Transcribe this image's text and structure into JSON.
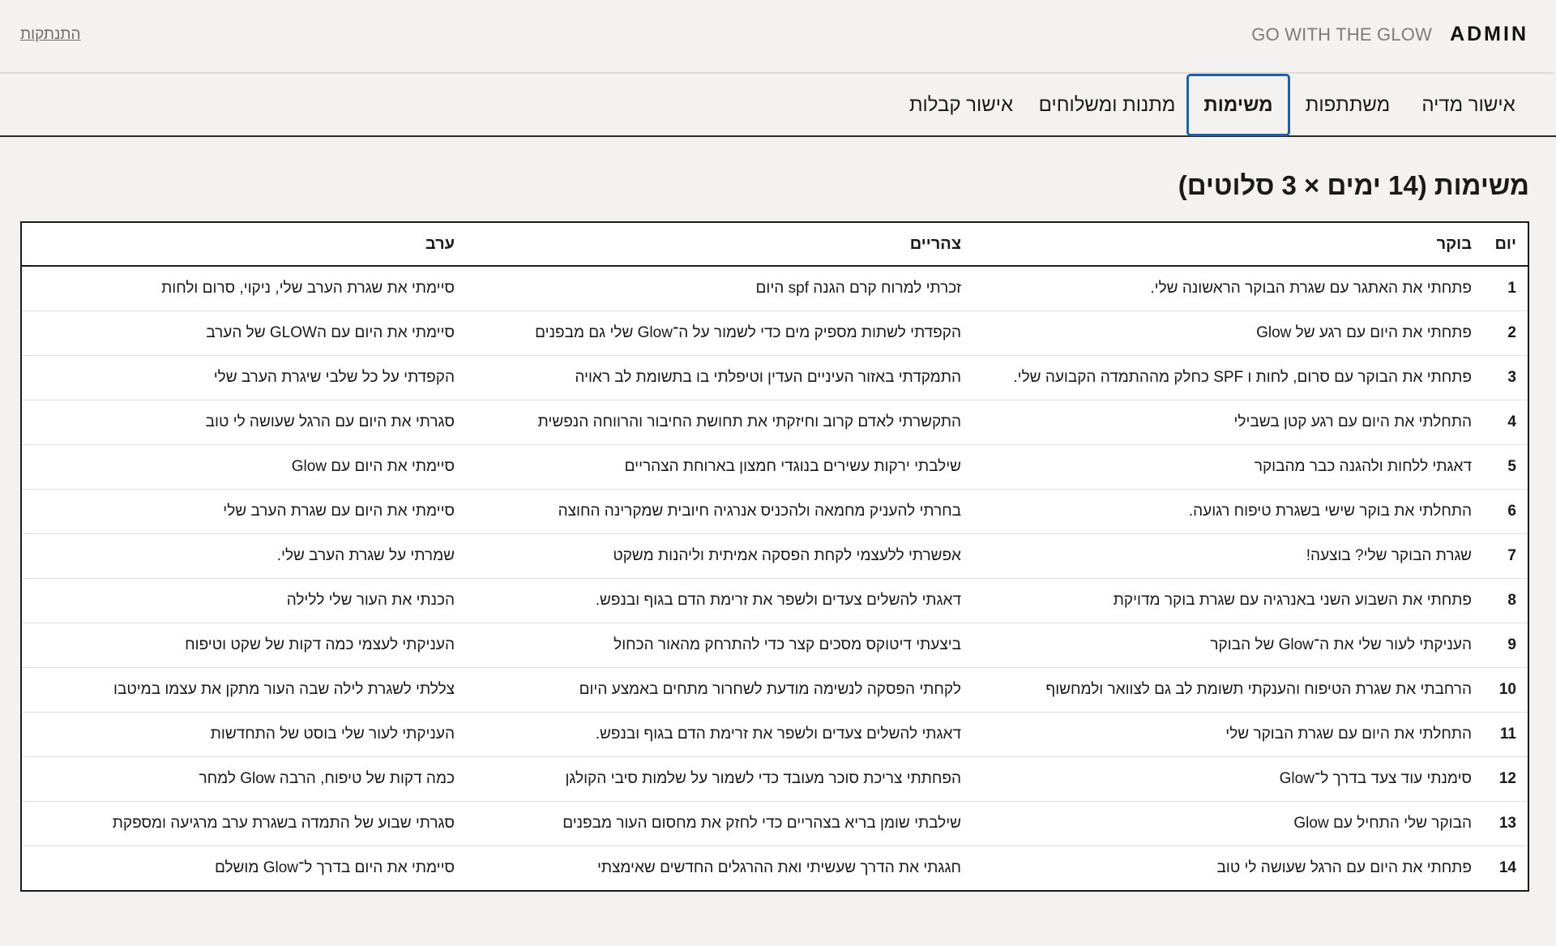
{
  "header": {
    "admin_label": "ADMIN",
    "tagline": "GO WITH THE GLOW",
    "logout_label": "התנתקות"
  },
  "tabs": [
    {
      "label": "אישור מדיה",
      "active": false
    },
    {
      "label": "משתתפות",
      "active": false
    },
    {
      "label": "משימות",
      "active": true
    },
    {
      "label": "מתנות ומשלוחים",
      "active": false
    },
    {
      "label": "אישור קבלות",
      "active": false
    }
  ],
  "page": {
    "title": "משימות (14 ימים × 3 סלוטים)"
  },
  "colors": {
    "background": "#f3f2f0",
    "active_tab_border": "#1f5fa8",
    "table_border": "#1a1a1a"
  },
  "table": {
    "headers": {
      "day": "יום",
      "morning": "בוקר",
      "noon": "צהריים",
      "evening": "ערב"
    },
    "rows": [
      {
        "day": "1",
        "morning": "פתחתי את האתגר עם שגרת הבוקר הראשונה שלי.",
        "noon": "זכרתי למרוח קרם הגנה spf היום",
        "evening": "סיימתי את שגרת הערב שלי, ניקוי, סרום ולחות"
      },
      {
        "day": "2",
        "morning": "פתחתי את היום עם רגע של Glow",
        "noon": "הקפדתי לשתות מספיק מים כדי לשמור על ה־Glow שלי גם מבפנים",
        "evening": "סיימתי את היום עם הGLOW של הערב"
      },
      {
        "day": "3",
        "morning": "פתחתי את הבוקר עם סרום, לחות ו SPF כחלק מההתמדה הקבועה שלי.",
        "noon": "התמקדתי באזור העיניים העדין וטיפלתי בו בתשומת לב ראויה",
        "evening": "הקפדתי על כל שלבי שיגרת הערב שלי"
      },
      {
        "day": "4",
        "morning": "התחלתי את היום עם רגע קטן בשבילי",
        "noon": "התקשרתי לאדם קרוב וחיזקתי את תחושת החיבור והרווחה הנפשית",
        "evening": "סגרתי את היום עם הרגל שעושה לי טוב"
      },
      {
        "day": "5",
        "morning": "דאגתי ללחות ולהגנה כבר מהבוקר",
        "noon": "שילבתי ירקות עשירים בנוגדי חמצון בארוחת הצהריים",
        "evening": "סיימתי את היום עם Glow"
      },
      {
        "day": "6",
        "morning": "התחלתי את בוקר שישי בשגרת טיפוח רגועה.",
        "noon": "בחרתי להעניק מחמאה ולהכניס אנרגיה חיובית שמקרינה החוצה",
        "evening": "סיימתי את היום עם שגרת הערב שלי"
      },
      {
        "day": "7",
        "morning": "שגרת הבוקר שלי? בוצעה!",
        "noon": "אפשרתי ללעצמי לקחת הפסקה אמיתית וליהנות משקט",
        "evening": "שמרתי על שגרת הערב שלי."
      },
      {
        "day": "8",
        "morning": "פתחתי את השבוע השני באנרגיה עם שגרת בוקר מדויקת",
        "noon": "דאגתי להשלים צעדים ולשפר את זרימת הדם בגוף ובנפש.",
        "evening": "הכנתי את העור שלי ללילה"
      },
      {
        "day": "9",
        "morning": "העניקתי לעור שלי את ה־Glow של הבוקר",
        "noon": "ביצעתי דיטוקס מסכים קצר כדי להתרחק מהאור הכחול",
        "evening": "העניקתי לעצמי כמה דקות של שקט וטיפוח"
      },
      {
        "day": "10",
        "morning": "הרחבתי את שגרת הטיפוח והענקתי תשומת לב גם לצוואר ולמחשוף",
        "noon": "לקחתי הפסקה לנשימה מודעת לשחרור מתחים באמצע היום",
        "evening": "צללתי לשגרת לילה שבה העור מתקן את עצמו במיטבו"
      },
      {
        "day": "11",
        "morning": "התחלתי את היום עם שגרת הבוקר שלי",
        "noon": "דאגתי להשלים צעדים ולשפר את זרימת הדם בגוף ובנפש.",
        "evening": "העניקתי לעור שלי בוסט של התחדשות"
      },
      {
        "day": "12",
        "morning": "סימנתי עוד צעד בדרך ל־Glow",
        "noon": "הפחתתי צריכת סוכר מעובד כדי לשמור על שלמות סיבי הקולגן",
        "evening": "כמה דקות של טיפוח, הרבה Glow למחר"
      },
      {
        "day": "13",
        "morning": "הבוקר שלי התחיל עם Glow",
        "noon": "שילבתי שומן בריא בצהריים כדי לחזק את מחסום העור מבפנים",
        "evening": "סגרתי שבוע של התמדה בשגרת ערב מרגיעה ומספקת"
      },
      {
        "day": "14",
        "morning": "פתחתי את היום עם הרגל שעושה לי טוב",
        "noon": "חגגתי את הדרך שעשיתי ואת ההרגלים החדשים שאימצתי",
        "evening": "סיימתי את היום בדרך ל־Glow מושלם"
      }
    ]
  }
}
